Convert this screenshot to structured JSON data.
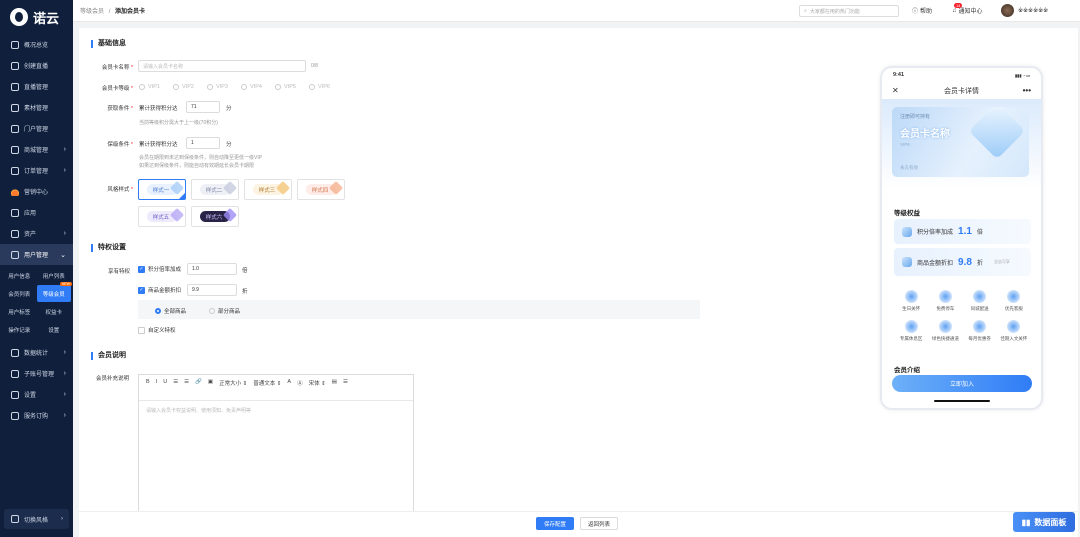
{
  "app": {
    "brand": "诺云"
  },
  "sidebar": {
    "items": [
      {
        "label": "概况总览",
        "icon": "dashboard-icon"
      },
      {
        "label": "创建直播",
        "icon": "video-icon"
      },
      {
        "label": "直播管理",
        "icon": "live-icon"
      },
      {
        "label": "素材管理",
        "icon": "folder-icon"
      },
      {
        "label": "门户管理",
        "icon": "home-icon"
      },
      {
        "label": "商城管理",
        "icon": "shop-icon",
        "arrow": "›"
      },
      {
        "label": "订单管理",
        "icon": "order-icon",
        "arrow": "›"
      },
      {
        "label": "营销中心",
        "icon": "fire-icon"
      },
      {
        "label": "应用",
        "icon": "apps-icon"
      },
      {
        "label": "资产",
        "icon": "asset-icon",
        "arrow": "›"
      },
      {
        "label": "用户管理",
        "icon": "user-icon",
        "arrow": "⌄"
      }
    ],
    "user_sub": [
      {
        "label": "用户信息"
      },
      {
        "label": "用户列表"
      },
      {
        "label": "会员列表"
      },
      {
        "label": "等级会员",
        "badge": "NEW"
      },
      {
        "label": "用户标签"
      },
      {
        "label": "权益卡"
      },
      {
        "label": "操作记录"
      },
      {
        "label": "设置"
      }
    ],
    "items2": [
      {
        "label": "数据统计",
        "icon": "chart-icon",
        "arrow": "›"
      },
      {
        "label": "子账号管理",
        "icon": "account-icon",
        "arrow": "›"
      },
      {
        "label": "设置",
        "icon": "settings-icon",
        "arrow": "›"
      },
      {
        "label": "服务订购",
        "icon": "cart-icon",
        "arrow": "›"
      }
    ],
    "switch_style": "切换风格",
    "switch_arrow": "›"
  },
  "topbar": {
    "crumb_parent": "等级会员",
    "crumb_sep": "/",
    "crumb_current": "添加会员卡",
    "search_placeholder": "大家都在用的热门功能",
    "help": "帮助",
    "notice": "通知中心",
    "notice_count": "14",
    "user_name": "※※※※※※"
  },
  "form": {
    "section_basic": "基础信息",
    "name_label": "会员卡名称",
    "name_placeholder": "请输入会员卡名称",
    "name_count": "0/8",
    "level_label": "会员卡等级",
    "levels": [
      "VIP1",
      "VIP2",
      "VIP3",
      "VIP4",
      "VIP5",
      "VIP6"
    ],
    "get_label": "获取条件",
    "get_prefix": "累计获得积分达",
    "get_value": "71",
    "get_unit": "分",
    "get_hint": "当前等级积分需大于上一级(70积分)",
    "keep_label": "保级条件",
    "keep_prefix": "累计获得积分达",
    "keep_value": "1",
    "keep_unit": "分",
    "keep_hint1": "会员在期限到未达到保级条件，则自动降至更低一级VIP",
    "keep_hint2": "如果达到保级条件，则能自动有效期延长会员卡期限",
    "style_label": "风格样式",
    "styles": [
      "样式一",
      "样式二",
      "样式三",
      "样式四",
      "样式五",
      "样式六"
    ],
    "section_priv": "特权设置",
    "priv_label": "享有特权",
    "priv_points": "积分倍率加成",
    "priv_points_value": "1.0",
    "priv_points_unit": "倍",
    "priv_discount": "商品金额折扣",
    "priv_discount_value": "9.9",
    "priv_discount_unit": "折",
    "scope_all": "全部商品",
    "scope_part": "部分商品",
    "priv_custom": "自定义特权",
    "section_desc": "会员说明",
    "desc_label": "会员补充说明",
    "editor_tools": [
      "B",
      "I",
      "U",
      "☰",
      "☰",
      "🔗",
      "▣",
      "正常大小 ⇕",
      "普通文本 ⇕",
      "A",
      "Ⓐ",
      "宋体 ⇕",
      "▤",
      "☰"
    ],
    "editor_placeholder": "请输入会员卡权益说明、使用须知、免责声明等"
  },
  "footer": {
    "save": "保存配置",
    "back": "返回列表",
    "dashboard": "数据面板"
  },
  "phone": {
    "time": "9:41",
    "signal": "▮▮▮ ◔ ▭",
    "title": "会员卡详情",
    "close": "✕",
    "more": "•••",
    "card_hint": "注册即可持有",
    "card_name": "会员卡名称",
    "card_level": "VIP6",
    "card_tag": "永久有效",
    "benefits_title": "等级权益",
    "benefit1_label": "积分倍率加成",
    "benefit1_value": "1.1",
    "benefit1_unit": "倍",
    "benefit2_label": "商品金额折扣",
    "benefit2_value": "9.8",
    "benefit2_unit": "折",
    "benefit2_note": "全店可享",
    "grid": [
      "生日关怀",
      "免费停车",
      "同城配送",
      "优先客服",
      "专属休息区",
      "绿色快捷通道",
      "每月优惠券",
      "佳期入文关怀"
    ],
    "intro_title": "会员介绍",
    "join": "立即加入"
  }
}
